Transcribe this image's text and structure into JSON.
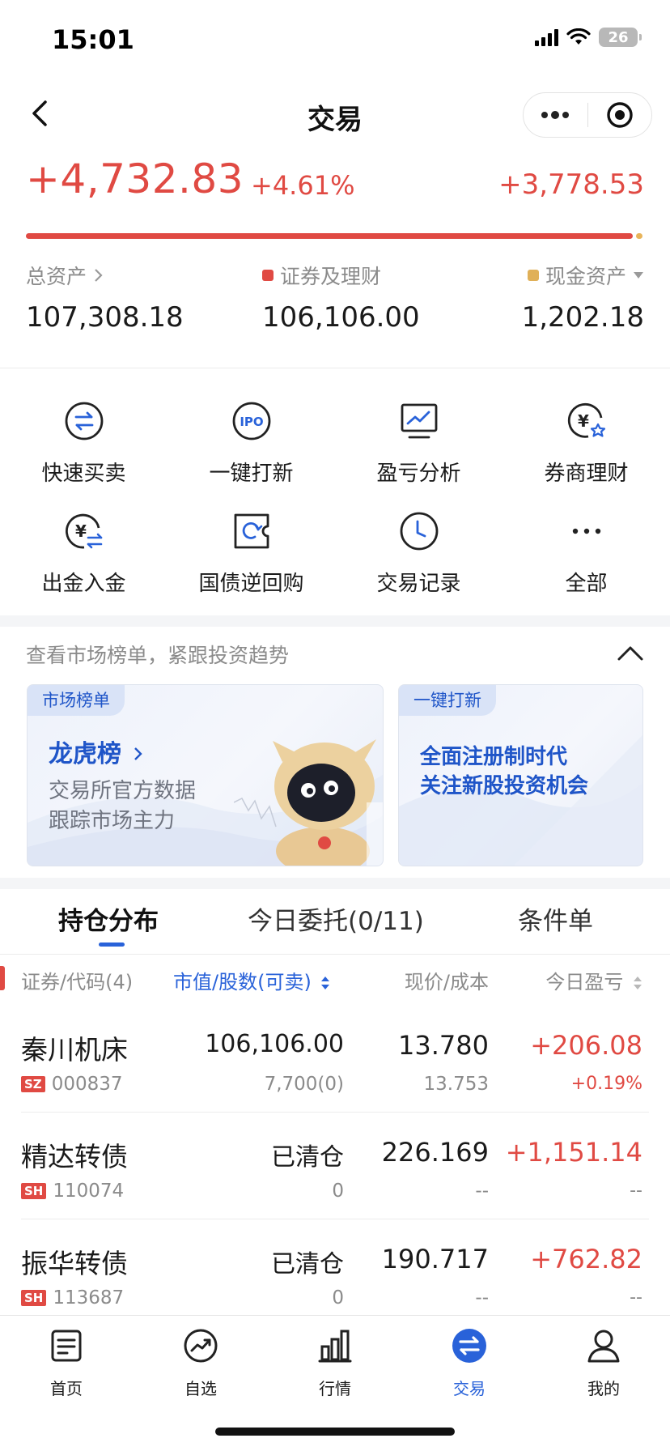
{
  "status": {
    "time": "15:01",
    "battery": "26"
  },
  "nav": {
    "title": "交易"
  },
  "pnl": {
    "total": "+4,732.83",
    "pct": "+4.61%",
    "right": "+3,778.53"
  },
  "assets": {
    "total_label": "总资产",
    "total_value": "107,308.18",
    "securities_label": "证券及理财",
    "securities_value": "106,106.00",
    "cash_label": "现金资产",
    "cash_value": "1,202.18",
    "colors": {
      "securities": "#e04a43",
      "cash": "#e0b058"
    }
  },
  "quick_actions": [
    {
      "label": "快速买卖",
      "icon": "swap-circle-icon"
    },
    {
      "label": "一键打新",
      "icon": "ipo-icon"
    },
    {
      "label": "盈亏分析",
      "icon": "chart-monitor-icon"
    },
    {
      "label": "券商理财",
      "icon": "yuan-star-icon"
    },
    {
      "label": "出金入金",
      "icon": "yuan-transfer-icon"
    },
    {
      "label": "国债逆回购",
      "icon": "refresh-ticket-icon"
    },
    {
      "label": "交易记录",
      "icon": "clock-icon"
    },
    {
      "label": "全部",
      "icon": "more-icon"
    }
  ],
  "market": {
    "header": "查看市场榜单，紧跟投资趋势",
    "card1": {
      "tag": "市场榜单",
      "title": "龙虎榜",
      "line1": "交易所官方数据",
      "line2": "跟踪市场主力"
    },
    "card2": {
      "tag": "一键打新",
      "line1": "全面注册制时代",
      "line2": "关注新股投资机会"
    }
  },
  "tabs": [
    {
      "label": "持仓分布"
    },
    {
      "label": "今日委托(0/11)"
    },
    {
      "label": "条件单"
    }
  ],
  "table": {
    "headers": [
      "证券/代码(4)",
      "市值/股数(可卖)",
      "现价/成本",
      "今日盈亏"
    ],
    "rows": [
      {
        "name": "秦川机床",
        "market": "SZ",
        "code": "000837",
        "mv": "106,106.00",
        "shares": "7,700(0)",
        "price": "13.780",
        "cost": "13.753",
        "pnl": "+206.08",
        "pnl_pct": "+0.19%"
      },
      {
        "name": "精达转债",
        "market": "SH",
        "code": "110074",
        "mv": "已清仓",
        "shares": "0",
        "price": "226.169",
        "cost": "--",
        "pnl": "+1,151.14",
        "pnl_pct": "--"
      },
      {
        "name": "振华转债",
        "market": "SH",
        "code": "113687",
        "mv": "已清仓",
        "shares": "0",
        "price": "190.717",
        "cost": "--",
        "pnl": "+762.82",
        "pnl_pct": "--"
      }
    ]
  },
  "bottom_nav": [
    {
      "label": "首页",
      "icon": "news-icon"
    },
    {
      "label": "自选",
      "icon": "trend-circle-icon"
    },
    {
      "label": "行情",
      "icon": "bar-chart-icon"
    },
    {
      "label": "交易",
      "icon": "swap-circle-icon"
    },
    {
      "label": "我的",
      "icon": "user-icon"
    }
  ],
  "active_bottom": "交易",
  "accent": "#2962d9",
  "up_color": "#e04a43"
}
